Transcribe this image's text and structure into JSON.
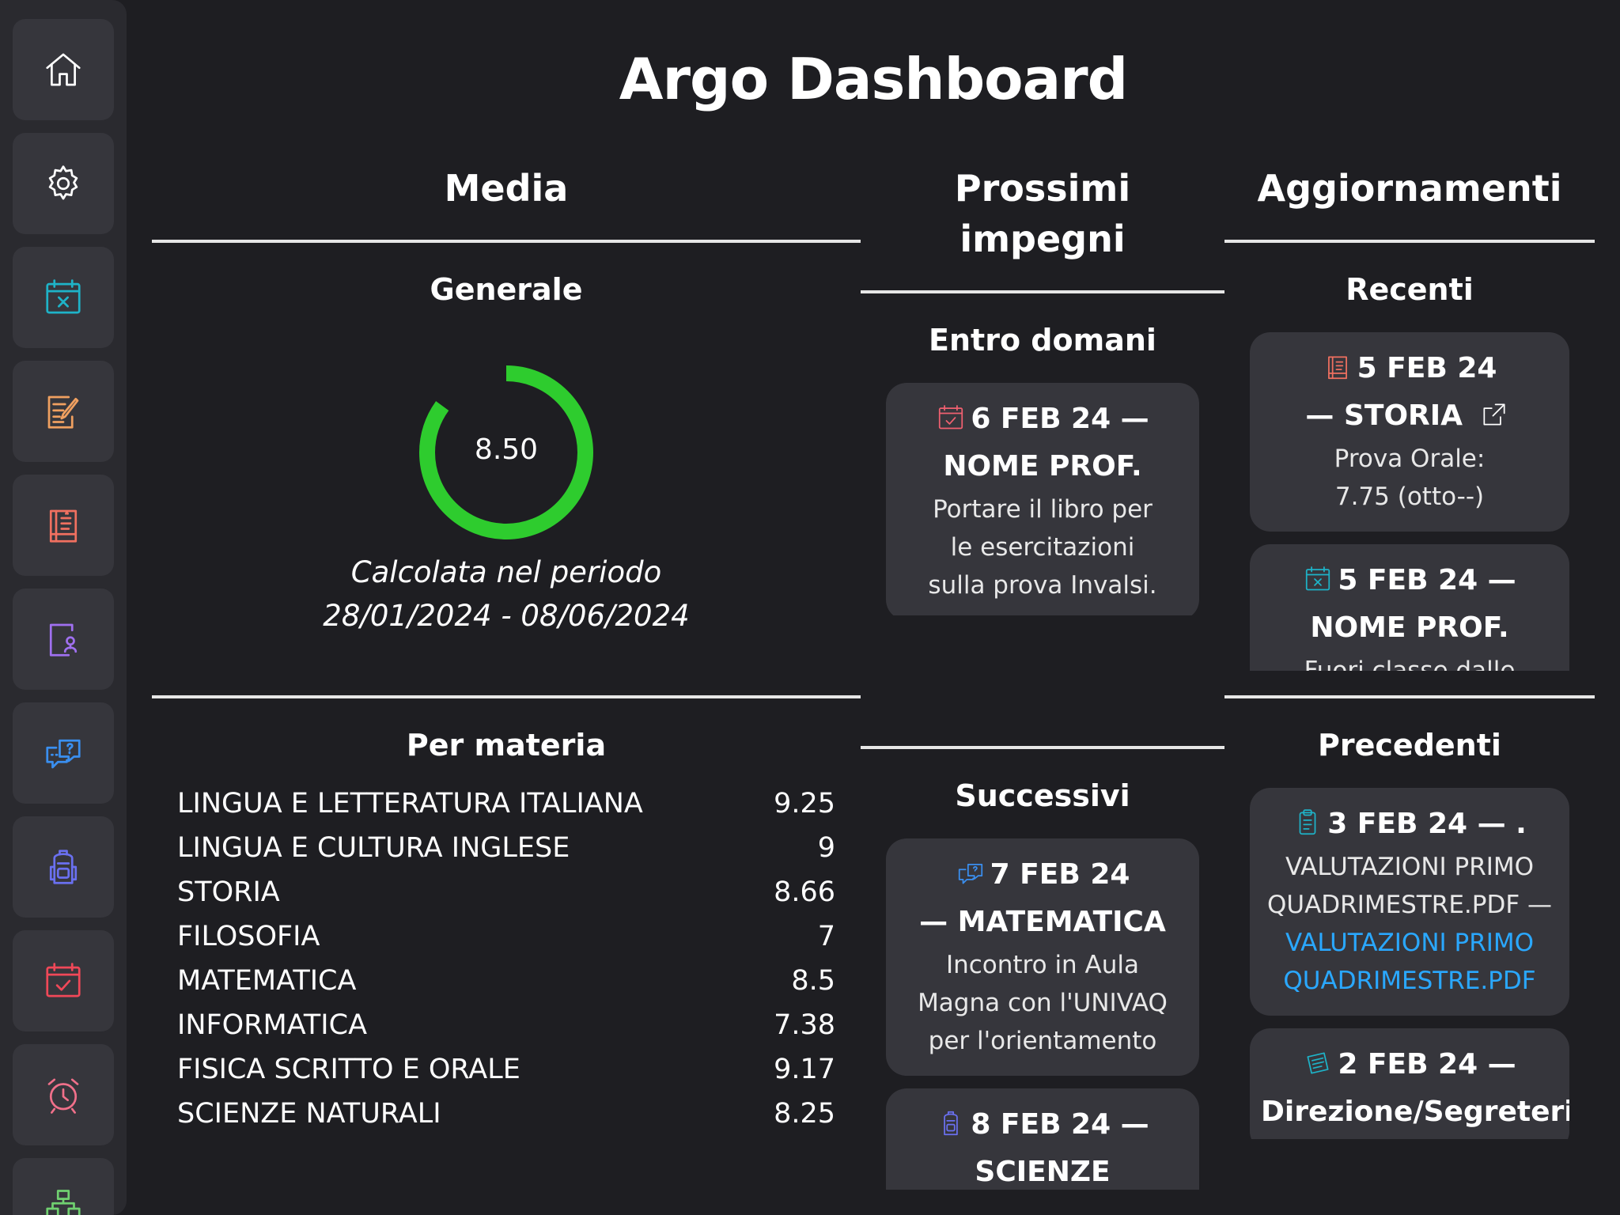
{
  "app": {
    "title": "Argo Dashboard"
  },
  "sidebar": {
    "items": [
      {
        "icon": "home-icon",
        "color": "#ffffff"
      },
      {
        "icon": "gear-icon",
        "color": "#ffffff"
      },
      {
        "icon": "calendar-x-icon",
        "color": "#1eb3c8"
      },
      {
        "icon": "note-edit-icon",
        "color": "#f0a060"
      },
      {
        "icon": "book-grade-icon",
        "color": "#f07060"
      },
      {
        "icon": "document-person-icon",
        "color": "#a070f0"
      },
      {
        "icon": "chat-question-icon",
        "color": "#3a8ff0"
      },
      {
        "icon": "backpack-icon",
        "color": "#6a70f0"
      },
      {
        "icon": "calendar-check-icon",
        "color": "#f04858"
      },
      {
        "icon": "alarm-icon",
        "color": "#f0708a"
      },
      {
        "icon": "network-icon",
        "color": "#70d070"
      }
    ]
  },
  "media": {
    "title": "Media",
    "general": {
      "title": "Generale",
      "value": "8.50",
      "fraction": 0.85,
      "accent": "#2ecc2e",
      "period_line1": "Calcolata nel periodo",
      "period_line2": "28/01/2024 - 08/06/2024"
    },
    "per_subject": {
      "title": "Per materia",
      "rows": [
        {
          "name": "LINGUA E LETTERATURA ITALIANA",
          "value": "9.25"
        },
        {
          "name": "LINGUA E CULTURA INGLESE",
          "value": "9"
        },
        {
          "name": "STORIA",
          "value": "8.66"
        },
        {
          "name": "FILOSOFIA",
          "value": "7"
        },
        {
          "name": "MATEMATICA",
          "value": "8.5"
        },
        {
          "name": "INFORMATICA",
          "value": "7.38"
        },
        {
          "name": "FISICA SCRITTO E ORALE",
          "value": "9.17"
        },
        {
          "name": "SCIENZE NATURALI",
          "value": "8.25"
        }
      ]
    }
  },
  "upcoming": {
    "title_line1": "Prossimi",
    "title_line2": "impegni",
    "by_tomorrow": {
      "title": "Entro domani",
      "cards": [
        {
          "icon": "calendar-check-icon",
          "icon_color": "#f06070",
          "line1": "6 FEB 24 —",
          "line2": "NOME PROF.",
          "body": [
            "Portare il libro per",
            "le esercitazioni",
            "sulla prova Invalsi."
          ]
        }
      ]
    },
    "later": {
      "title": "Successivi",
      "cards": [
        {
          "icon": "chat-question-icon",
          "icon_color": "#3a8ff0",
          "line1": "7 FEB 24",
          "line2": "— MATEMATICA",
          "body": [
            "Incontro in Aula",
            "Magna con l'UNIVAQ",
            "per l'orientamento"
          ]
        },
        {
          "icon": "backpack-icon",
          "icon_color": "#6a70f0",
          "line1": "8 FEB 24 —",
          "line2": "SCIENZE NATURALI",
          "body": []
        }
      ]
    }
  },
  "updates": {
    "title": "Aggiornamenti",
    "recent": {
      "title": "Recenti",
      "cards": [
        {
          "icon": "book-grade-icon",
          "icon_color": "#f07060",
          "line1": "5 FEB 24",
          "line2": "— STORIA",
          "external_icon": "external-link-icon",
          "body": [
            "Prova Orale:",
            "7.75 (otto--)"
          ]
        },
        {
          "icon": "calendar-x-icon",
          "icon_color": "#1eb3c8",
          "line1": "5 FEB 24 —",
          "line2": "NOME PROF.",
          "body": [
            "Fuori classe dalle"
          ]
        }
      ]
    },
    "previous": {
      "title": "Precedenti",
      "cards": [
        {
          "icon": "clipboard-icon",
          "icon_color": "#1eb3c8",
          "line1": "3 FEB 24 — .",
          "body": [
            "VALUTAZIONI PRIMO",
            "QUADRIMESTRE.PDF —"
          ],
          "links": [
            "VALUTAZIONI PRIMO",
            "QUADRIMESTRE.PDF"
          ]
        },
        {
          "icon": "notepad-icon",
          "icon_color": "#1eb3c8",
          "line1": "2 FEB 24 —",
          "line2": "Direzione/Segreteria",
          "body": []
        }
      ]
    }
  }
}
